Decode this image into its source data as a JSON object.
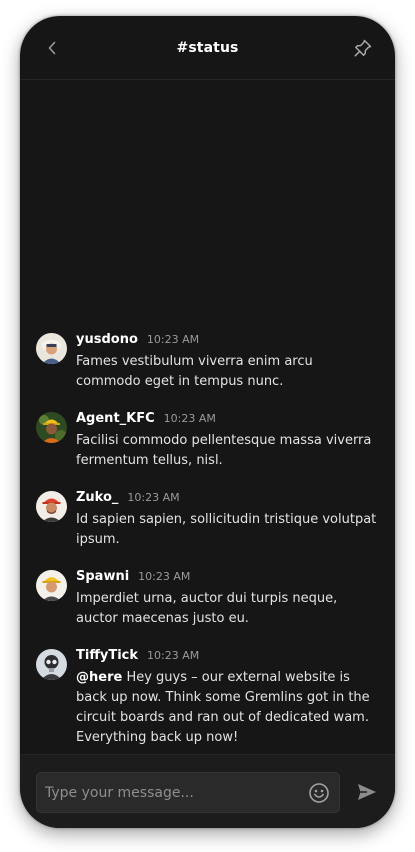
{
  "header": {
    "title": "#status",
    "back_icon": "chevron-left-icon",
    "pin_icon": "pin-icon"
  },
  "messages": [
    {
      "author": "yusdono",
      "time": "10:23 AM",
      "text": "Fames vestibulum viverra enim arcu commodo eget in tempus nunc.",
      "avatar_bg": "#e8e2d6"
    },
    {
      "author": "Agent_KFC",
      "time": "10:23 AM",
      "text": "Facilisi commodo pellentesque massa viverra fermentum tellus, nisl.",
      "avatar_bg": "#3a4a2a"
    },
    {
      "author": "Zuko_",
      "time": "10:23 AM",
      "text": "Id sapien sapien, sollicitudin tristique volutpat ipsum.",
      "avatar_bg": "#f2ece4"
    },
    {
      "author": "Spawni",
      "time": "10:23 AM",
      "text": "Imperdiet urna, auctor dui turpis neque, auctor maecenas justo eu.",
      "avatar_bg": "#f4f0ea"
    },
    {
      "author": "TiffyTick",
      "time": "10:23 AM",
      "mention": "@here",
      "text": " Hey guys – our external website is back up now. Think some Gremlins got in the circuit boards and ran out of dedicated wam. Everything back up now!",
      "avatar_bg": "#d9dde2"
    }
  ],
  "composer": {
    "placeholder": "Type your message...",
    "emoji_icon": "smiley-icon",
    "send_icon": "send-icon"
  },
  "colors": {
    "background": "#161616",
    "footer": "#1c1c1c",
    "input": "#2a2a2a"
  }
}
